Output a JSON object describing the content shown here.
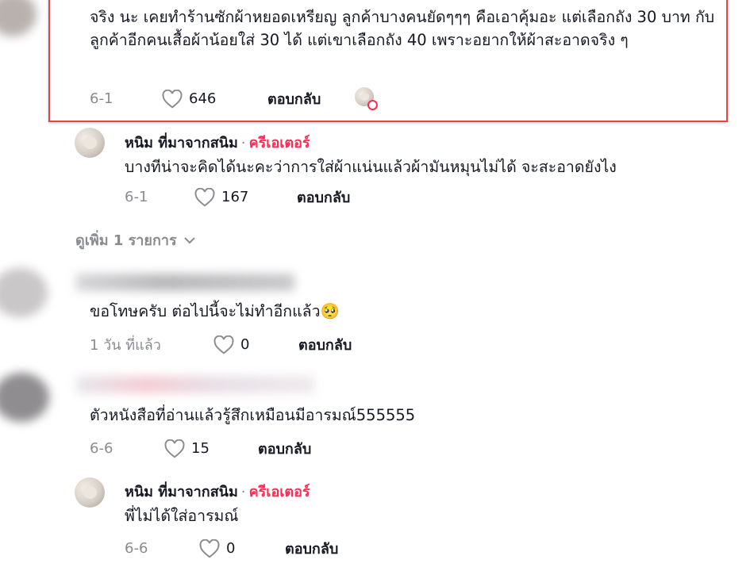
{
  "comments": [
    {
      "text": "จริง นะ เคยทำร้านซักผ้าหยอดเหรียญ ลูกค้าบางคนยัดๆๆๆ คือเอาคุ้มอะ แต่เลือกถัง 30 บาท กับลูกค้าอีกคนเสื้อผ้าน้อยใส่ 30 ได้ แต่เขาเลือกถัง 40 เพราะอยากให้ผ้าสะอาดจริง ๆ",
      "date": "6-1",
      "likes": "646",
      "reply": "ตอบกลับ"
    },
    {
      "author": "หนิม ที่มาจากสนิม",
      "dot": "·",
      "badge": "ครีเอเตอร์",
      "text": "บางทีน่าจะคิดได้นะคะว่าการใส่ผ้าแน่นแล้วผ้ามันหมุนไม่ได้ จะสะอาดยังไง",
      "date": "6-1",
      "likes": "167",
      "reply": "ตอบกลับ"
    },
    {
      "view_more": "ดูเพิ่ม 1 รายการ"
    },
    {
      "text": "ขอโทษครับ ต่อไปนี้จะไม่ทำอีกแล้ว🥺",
      "date": "1 วัน ที่แล้ว",
      "likes": "0",
      "reply": "ตอบกลับ"
    },
    {
      "text": "ตัวหนังสือที่อ่านแล้วรู้สึกเหมือนมีอารมณ์555555",
      "date": "6-6",
      "likes": "15",
      "reply": "ตอบกลับ"
    },
    {
      "author": "หนิม ที่มาจากสนิม",
      "dot": "·",
      "badge": "ครีเอเตอร์",
      "text": "พี่ไม่ได้ใส่อารมณ์",
      "date": "6-6",
      "likes": "0",
      "reply": "ตอบกลับ"
    }
  ],
  "colors": {
    "creator_badge": "#fe2c55",
    "highlight_border": "#e04848",
    "muted_text": "#8a8b91"
  },
  "icons": [
    "heart-outline-icon",
    "chevron-down-icon",
    "avatar-image"
  ]
}
